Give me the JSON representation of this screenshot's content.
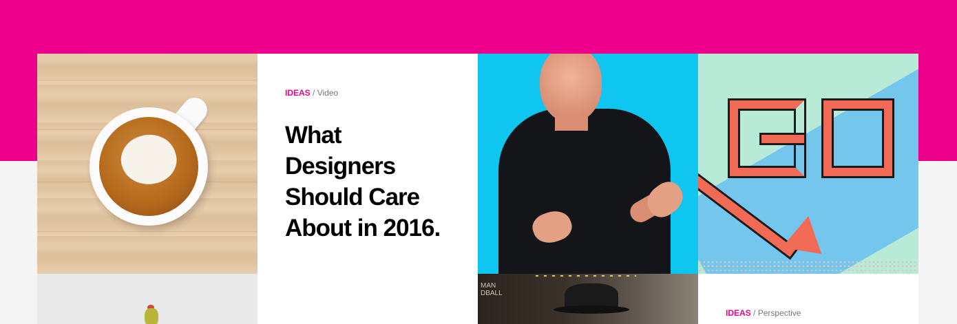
{
  "colors": {
    "accent": "#ec008c",
    "meta_text": "#777777"
  },
  "tiles": {
    "coffee": {
      "image": "coffee-cup-on-wood"
    },
    "article": {
      "category": "IDEAS",
      "separator": "/",
      "type": "Video",
      "title": "What Designers Should Care About in 2016."
    },
    "portrait": {
      "image": "man-gesturing-on-blue"
    },
    "go": {
      "image": "monopoly-go-square"
    },
    "grey": {
      "image": "partial-illustration"
    },
    "theater": {
      "image": "man-in-fedora-theater",
      "sign_text": "MAN\nDBALL"
    },
    "article2": {
      "category": "IDEAS",
      "separator": "/",
      "type": "Perspective"
    }
  }
}
